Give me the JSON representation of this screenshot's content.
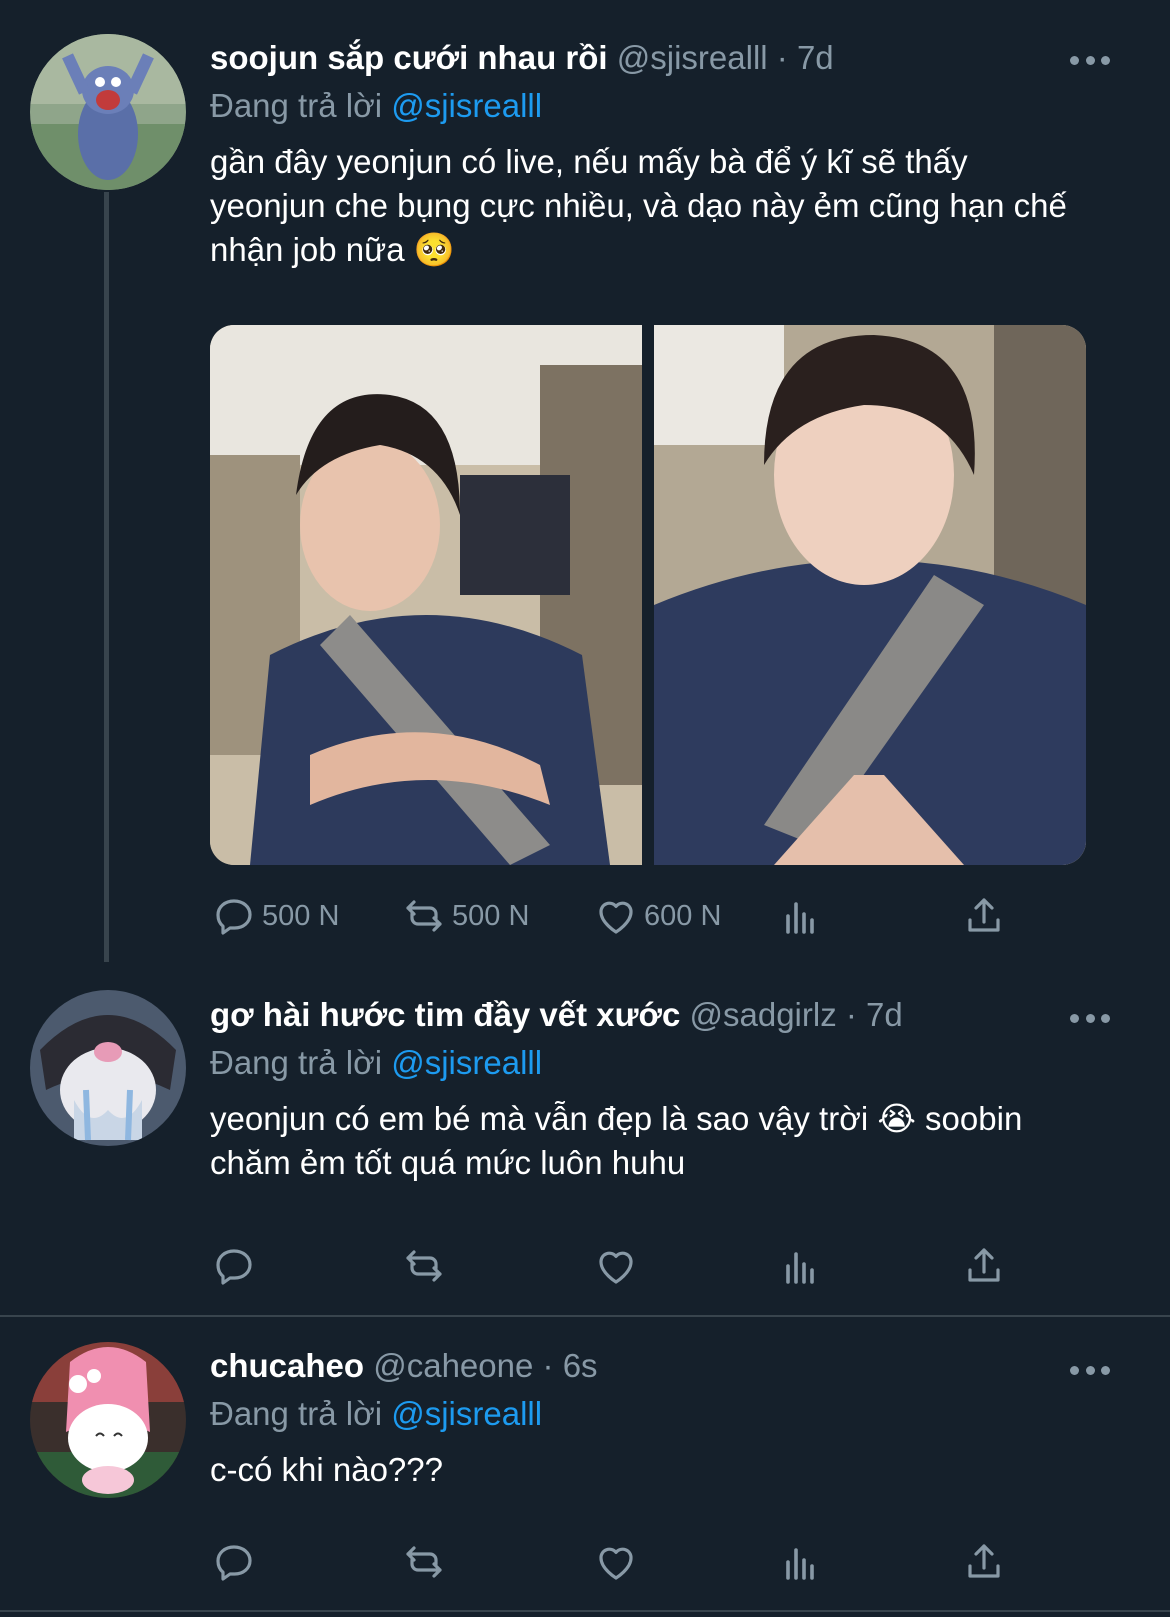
{
  "tweets": [
    {
      "display_name": "soojun sắp cưới nhau rồi",
      "handle": "@sjisrealll",
      "sep": "·",
      "time": "7d",
      "reply_prefix": "Đang trả lời",
      "reply_to": "@sjisrealll",
      "text": "gần đây yeonjun có live, nếu mấy bà để ý kĩ sẽ thấy yeonjun che bụng cực nhiều, và dạo này ẻm cũng hạn chế nhận job nữa 🥺",
      "reply_count": "500 N",
      "retweet_count": "500 N",
      "like_count": "600 N"
    },
    {
      "display_name": "gơ hài hước tim đầy vết xước",
      "handle": "@sadgirlz",
      "sep": "·",
      "time": "7d",
      "reply_prefix": "Đang trả lời",
      "reply_to": "@sjisrealll",
      "text": "yeonjun có em bé mà vẫn đẹp là sao vậy trời 😭 soobin chăm ẻm tốt quá mức luôn huhu"
    },
    {
      "display_name": "chucaheo",
      "handle": "@caheone",
      "sep": "·",
      "time": "6s",
      "reply_prefix": "Đang trả lời",
      "reply_to": "@sjisrealll",
      "text": "c-có khi nào???"
    }
  ],
  "colors": {
    "background": "#15202b",
    "text_secondary": "#8899a6",
    "link": "#1d9bf0",
    "divider": "#38444d"
  },
  "icons": [
    "reply-icon",
    "retweet-icon",
    "like-icon",
    "analytics-icon",
    "share-icon",
    "more-icon"
  ]
}
